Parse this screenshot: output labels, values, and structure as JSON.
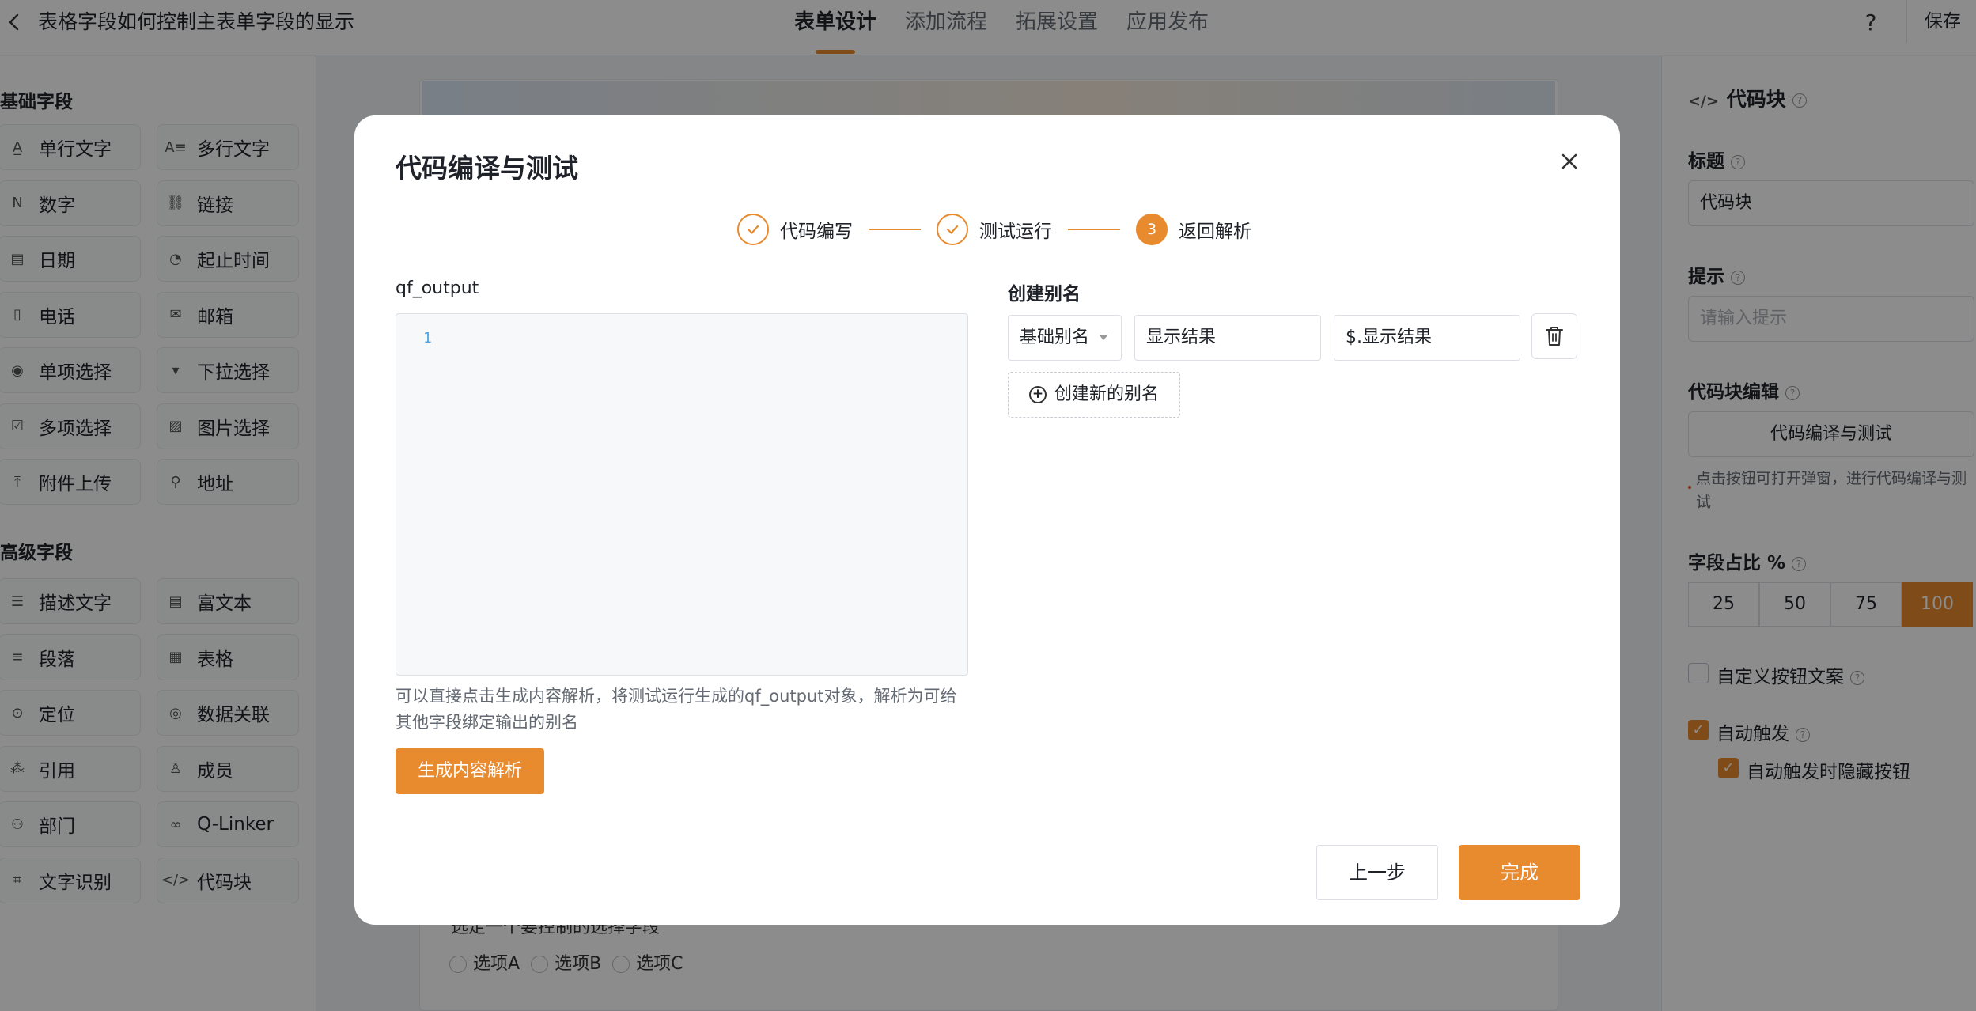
{
  "topbar": {
    "back_icon": "chevron-left-icon",
    "title": "表格字段如何控制主表单字段的显示",
    "tabs": [
      "表单设计",
      "添加流程",
      "拓展设置",
      "应用发布"
    ],
    "active_tab": 0,
    "help_icon": "question-icon",
    "help_glyph": "?",
    "save_label": "保存"
  },
  "left_panel": {
    "basic_title": "基础字段",
    "basic_fields": [
      {
        "label": "单行文字",
        "icon": "text-line-icon",
        "glyph": "A̲"
      },
      {
        "label": "多行文字",
        "icon": "text-multi-icon",
        "glyph": "A≡"
      },
      {
        "label": "数字",
        "icon": "number-icon",
        "glyph": "N"
      },
      {
        "label": "链接",
        "icon": "link-icon",
        "glyph": "⛓"
      },
      {
        "label": "日期",
        "icon": "calendar-icon",
        "glyph": "▤"
      },
      {
        "label": "起止时间",
        "icon": "time-range-icon",
        "glyph": "◔"
      },
      {
        "label": "电话",
        "icon": "phone-icon",
        "glyph": "▯"
      },
      {
        "label": "邮箱",
        "icon": "mail-icon",
        "glyph": "✉"
      },
      {
        "label": "单项选择",
        "icon": "radio-icon",
        "glyph": "◉"
      },
      {
        "label": "下拉选择",
        "icon": "dropdown-icon",
        "glyph": "▾"
      },
      {
        "label": "多项选择",
        "icon": "checkbox-icon",
        "glyph": "☑"
      },
      {
        "label": "图片选择",
        "icon": "image-icon",
        "glyph": "▨"
      },
      {
        "label": "附件上传",
        "icon": "upload-icon",
        "glyph": "⤒"
      },
      {
        "label": "地址",
        "icon": "location-icon",
        "glyph": "⚲"
      }
    ],
    "advanced_title": "高级字段",
    "advanced_fields": [
      {
        "label": "描述文字",
        "icon": "description-icon",
        "glyph": "☰"
      },
      {
        "label": "富文本",
        "icon": "rich-text-icon",
        "glyph": "▤"
      },
      {
        "label": "段落",
        "icon": "paragraph-icon",
        "glyph": "≡"
      },
      {
        "label": "表格",
        "icon": "table-icon",
        "glyph": "▦"
      },
      {
        "label": "定位",
        "icon": "position-icon",
        "glyph": "⊙"
      },
      {
        "label": "数据关联",
        "icon": "data-link-icon",
        "glyph": "◎"
      },
      {
        "label": "引用",
        "icon": "reference-icon",
        "glyph": "⁂"
      },
      {
        "label": "成员",
        "icon": "user-icon",
        "glyph": "♙"
      },
      {
        "label": "部门",
        "icon": "department-icon",
        "glyph": "⚇"
      },
      {
        "label": "Q-Linker",
        "icon": "qlinker-icon",
        "glyph": "∞"
      },
      {
        "label": "文字识别",
        "icon": "ocr-icon",
        "glyph": "⌗"
      },
      {
        "label": "代码块",
        "icon": "code-icon",
        "glyph": "</>"
      }
    ]
  },
  "canvas": {
    "question": "选定一个要控制的选择字段",
    "options": [
      "选项A",
      "选项B",
      "选项C"
    ]
  },
  "right_panel": {
    "header": "代码块",
    "header_icon": "code-icon",
    "title_label": "标题",
    "title_value": "代码块",
    "hint_label": "提示",
    "hint_placeholder": "请输入提示",
    "editor_label": "代码块编辑",
    "editor_button": "代码编译与测试",
    "editor_hint": "点击按钮可打开弹窗，进行代码编译与测试",
    "width_label": "字段占比 %",
    "width_options": [
      "25",
      "50",
      "75",
      "100"
    ],
    "width_selected": "100",
    "custom_btn_label": "自定义按钮文案",
    "custom_btn_checked": false,
    "auto_trigger_label": "自动触发",
    "auto_trigger_checked": true,
    "auto_hide_label": "自动触发时隐藏按钮",
    "auto_hide_checked": true
  },
  "modal": {
    "title": "代码编译与测试",
    "close_icon": "close-icon",
    "steps": [
      {
        "label": "代码编写",
        "status": "done"
      },
      {
        "label": "测试运行",
        "status": "done"
      },
      {
        "label": "返回解析",
        "status": "current",
        "number": "3"
      }
    ],
    "output_label": "qf_output",
    "editor_line_number": "1",
    "editor_hint": "可以直接点击生成内容解析，将测试运行生成的qf_output对象，解析为可给其他字段绑定输出的别名",
    "generate_button": "生成内容解析",
    "alias_title": "创建别名",
    "alias_row": {
      "type": "基础别名",
      "name": "显示结果",
      "path": "$.显示结果",
      "delete_icon": "trash-icon"
    },
    "add_alias_button": "创建新的别名",
    "prev_button": "上一步",
    "done_button": "完成"
  },
  "colors": {
    "accent": "#e88a2e",
    "overlay": "rgba(0,0,0,0.45)"
  }
}
